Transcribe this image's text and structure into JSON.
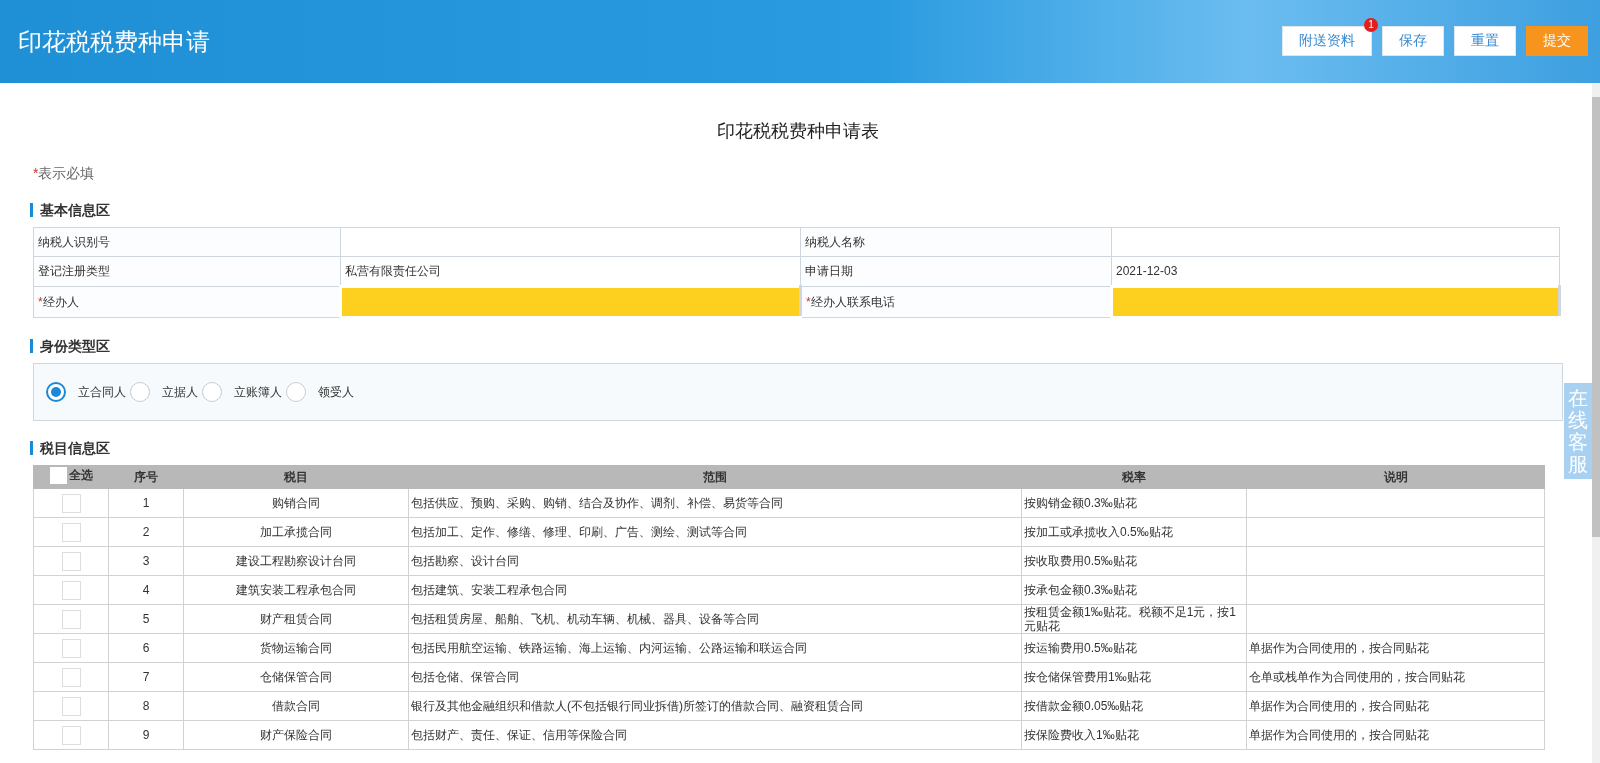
{
  "header": {
    "title": "印花税税费种申请",
    "buttons": [
      {
        "label": "附送资料",
        "kind": "plain",
        "badge": "1"
      },
      {
        "label": "保存",
        "kind": "plain"
      },
      {
        "label": "重置",
        "kind": "plain"
      },
      {
        "label": "提交",
        "kind": "primary"
      }
    ]
  },
  "form_title": "印花税税费种申请表",
  "required_note": {
    "mark": "*",
    "text": "表示必填"
  },
  "basic_info": {
    "title": "基本信息区",
    "rows": [
      {
        "label": "纳税人识别号",
        "required": false,
        "value": "",
        "highlight": false,
        "label2": "纳税人名称",
        "required2": false,
        "value2": "",
        "highlight2": false
      },
      {
        "label": "登记注册类型",
        "required": false,
        "value": "私营有限责任公司",
        "highlight": false,
        "label2": "申请日期",
        "required2": false,
        "value2": "2021-12-03",
        "highlight2": false
      },
      {
        "label": "经办人",
        "required": true,
        "value": "",
        "highlight": true,
        "label2": "经办人联系电话",
        "required2": true,
        "value2": "",
        "highlight2": true
      }
    ]
  },
  "identity": {
    "title": "身份类型区",
    "options": [
      {
        "label": "立合同人",
        "selected": true
      },
      {
        "label": "立据人",
        "selected": false
      },
      {
        "label": "立账簿人",
        "selected": false
      },
      {
        "label": "领受人",
        "selected": false
      }
    ]
  },
  "items": {
    "title": "税目信息区",
    "select_all": {
      "label": "全选",
      "checked": false
    },
    "columns": [
      "序号",
      "税目",
      "范围",
      "税率",
      "说明"
    ],
    "rows": [
      {
        "checked": false,
        "no": "1",
        "item": "购销合同",
        "scope": "包括供应、预购、采购、购销、结合及协作、调剂、补偿、易货等合同",
        "rate": "按购销金额0.3‰贴花",
        "note": ""
      },
      {
        "checked": false,
        "no": "2",
        "item": "加工承揽合同",
        "scope": "包括加工、定作、修缮、修理、印刷、广告、测绘、测试等合同",
        "rate": "按加工或承揽收入0.5‰贴花",
        "note": ""
      },
      {
        "checked": false,
        "no": "3",
        "item": "建设工程勘察设计台同",
        "scope": "包括勘察、设计台同",
        "rate": "按收取费用0.5‰贴花",
        "note": ""
      },
      {
        "checked": false,
        "no": "4",
        "item": "建筑安装工程承包合同",
        "scope": "包括建筑、安装工程承包合同",
        "rate": "按承包金额0.3‰贴花",
        "note": ""
      },
      {
        "checked": false,
        "no": "5",
        "item": "财产租赁合同",
        "scope": "包括租赁房屋、船舶、飞机、机动车辆、机械、器具、设备等合同",
        "rate": "按租赁金额1‰贴花。税额不足1元，按1元贴花",
        "note": ""
      },
      {
        "checked": false,
        "no": "6",
        "item": "货物运输合同",
        "scope": "包括民用航空运输、铁路运输、海上运输、内河运输、公路运输和联运合同",
        "rate": "按运输费用0.5‰贴花",
        "note": "单据作为合同使用的，按合同贴花"
      },
      {
        "checked": false,
        "no": "7",
        "item": "仓储保管合同",
        "scope": "包括仓储、保管合同",
        "rate": "按仓储保管费用1‰贴花",
        "note": "仓单或栈单作为合同使用的，按合同贴花"
      },
      {
        "checked": false,
        "no": "8",
        "item": "借款合同",
        "scope": "银行及其他金融组织和借款人(不包括银行同业拆借)所签订的借款合同、融资租赁合同",
        "rate": "按借款金额0.05‰贴花",
        "note": "单据作为合同使用的，按合同贴花"
      },
      {
        "checked": false,
        "no": "9",
        "item": "财产保险合同",
        "scope": "包括财产、责任、保证、信用等保险合同",
        "rate": "按保险费收入1‰贴花",
        "note": "单据作为合同使用的，按合同贴花"
      }
    ]
  },
  "service_tab": "在线客服"
}
